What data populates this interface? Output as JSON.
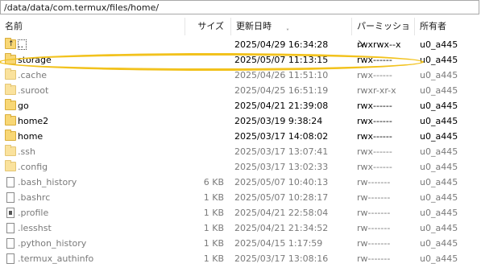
{
  "path": "/data/data/com.termux/files/home/",
  "columns": {
    "name": "名前",
    "size": "サイズ",
    "date": "更新日時",
    "perm": "パーミッション",
    "owner": "所有者"
  },
  "highlight_color": "#f2c21d",
  "rows": [
    {
      "name": "..",
      "size": "",
      "date": "2025/04/29 16:34:28",
      "perm": "rwxrwx--x",
      "owner": "u0_a445",
      "icon": "parent-folder-icon",
      "hidden": false
    },
    {
      "name": "storage",
      "size": "",
      "date": "2025/05/07 11:13:15",
      "perm": "rwx------",
      "owner": "u0_a445",
      "icon": "folder-icon",
      "hidden": false
    },
    {
      "name": ".cache",
      "size": "",
      "date": "2025/04/26 11:51:10",
      "perm": "rwx------",
      "owner": "u0_a445",
      "icon": "folder-icon",
      "hidden": true
    },
    {
      "name": ".suroot",
      "size": "",
      "date": "2025/04/25 16:51:19",
      "perm": "rwxr-xr-x",
      "owner": "u0_a445",
      "icon": "folder-icon",
      "hidden": true
    },
    {
      "name": "go",
      "size": "",
      "date": "2025/04/21 21:39:08",
      "perm": "rwx------",
      "owner": "u0_a445",
      "icon": "folder-icon",
      "hidden": false
    },
    {
      "name": "home2",
      "size": "",
      "date": "2025/03/19 9:38:24",
      "perm": "rwx------",
      "owner": "u0_a445",
      "icon": "folder-icon",
      "hidden": false
    },
    {
      "name": "home",
      "size": "",
      "date": "2025/03/17 14:08:02",
      "perm": "rwx------",
      "owner": "u0_a445",
      "icon": "folder-icon",
      "hidden": false
    },
    {
      "name": ".ssh",
      "size": "",
      "date": "2025/03/17 13:07:41",
      "perm": "rwx------",
      "owner": "u0_a445",
      "icon": "folder-icon",
      "hidden": true
    },
    {
      "name": ".config",
      "size": "",
      "date": "2025/03/17 13:02:33",
      "perm": "rwx------",
      "owner": "u0_a445",
      "icon": "folder-icon",
      "hidden": true
    },
    {
      "name": ".bash_history",
      "size": "6 KB",
      "date": "2025/05/07 10:40:13",
      "perm": "rw-------",
      "owner": "u0_a445",
      "icon": "file-icon",
      "hidden": true
    },
    {
      "name": ".bashrc",
      "size": "1 KB",
      "date": "2025/05/07 10:28:17",
      "perm": "rw-------",
      "owner": "u0_a445",
      "icon": "file-icon",
      "hidden": true
    },
    {
      "name": ".profile",
      "size": "1 KB",
      "date": "2025/04/21 22:58:04",
      "perm": "rw-------",
      "owner": "u0_a445",
      "icon": "settings-file-icon",
      "hidden": true
    },
    {
      "name": ".lesshst",
      "size": "1 KB",
      "date": "2025/04/21 21:34:52",
      "perm": "rw-------",
      "owner": "u0_a445",
      "icon": "file-icon",
      "hidden": true
    },
    {
      "name": ".python_history",
      "size": "1 KB",
      "date": "2025/04/15 1:17:59",
      "perm": "rw-------",
      "owner": "u0_a445",
      "icon": "file-icon",
      "hidden": true
    },
    {
      "name": ".termux_authinfo",
      "size": "1 KB",
      "date": "2025/03/17 13:08:16",
      "perm": "rw-------",
      "owner": "u0_a445",
      "icon": "file-icon",
      "hidden": true
    }
  ]
}
